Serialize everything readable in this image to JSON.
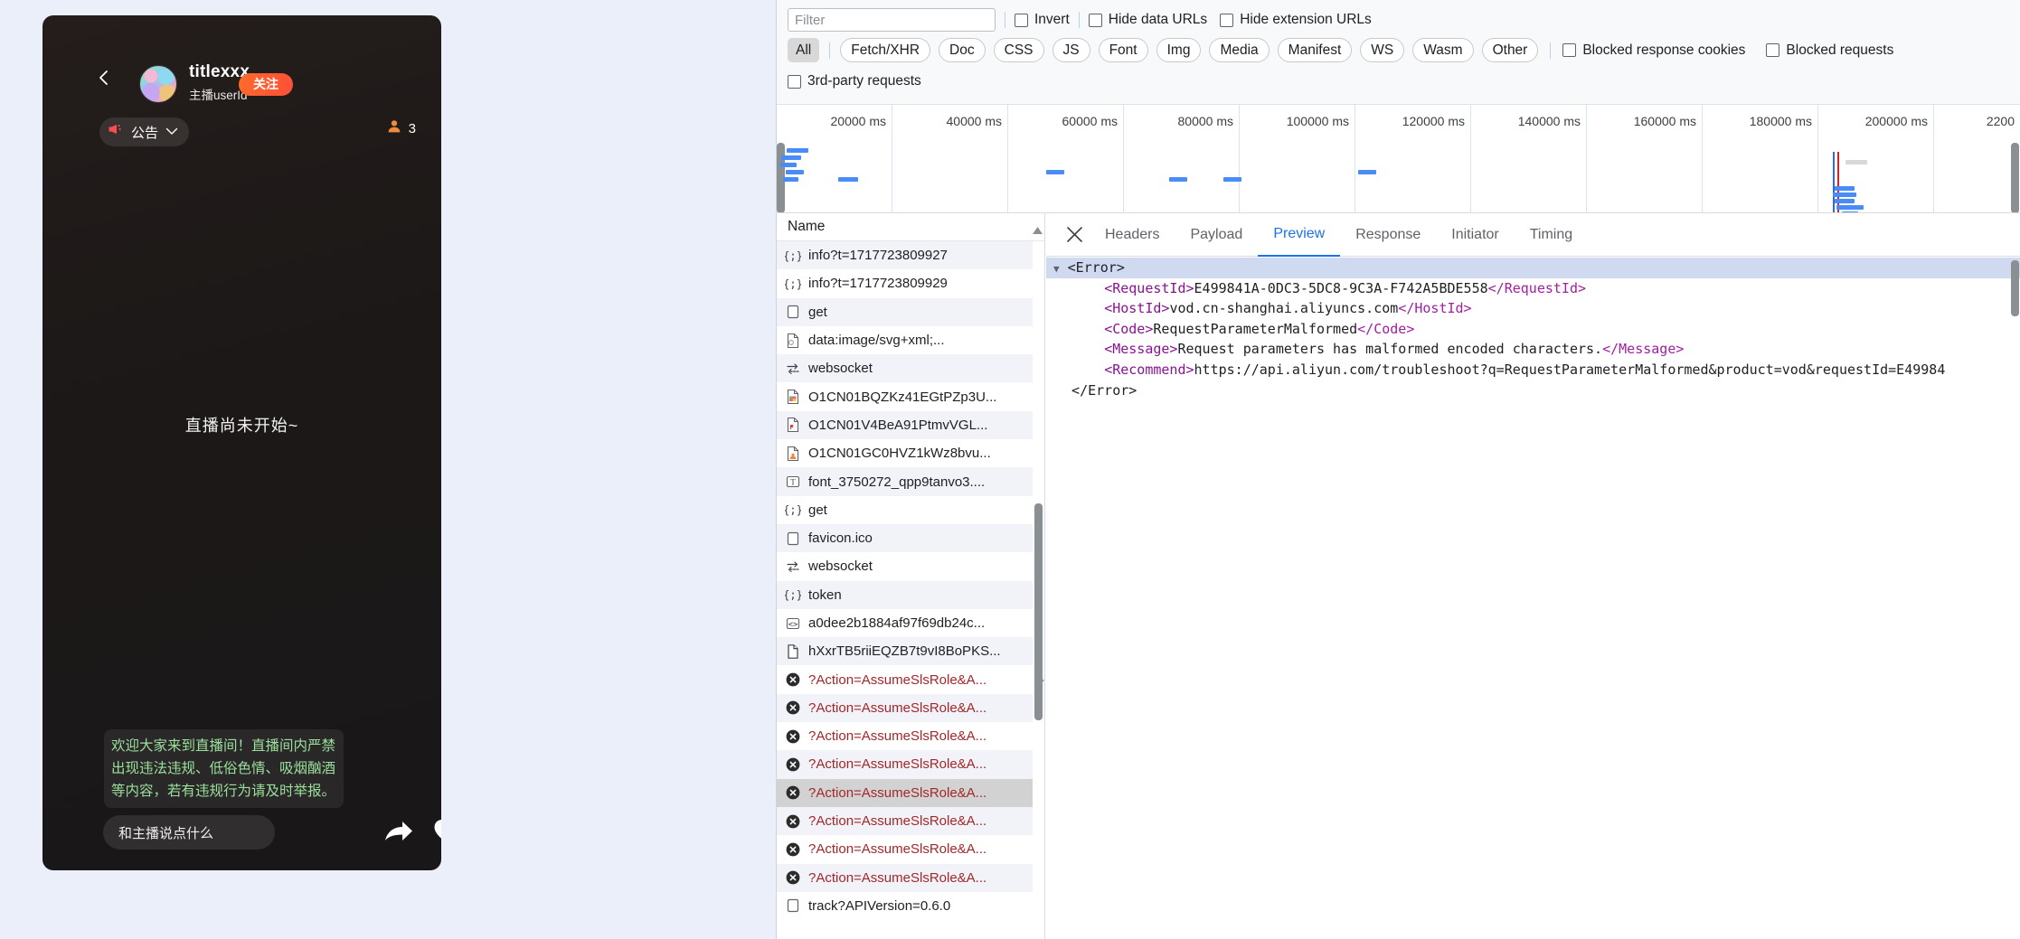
{
  "live": {
    "back_icon": "chevron-left-icon",
    "host_name": "titlexxx",
    "host_sub": "主播userId",
    "follow_label": "关注",
    "notice_label": "公告",
    "notice_icon": "megaphone-icon",
    "chevron_icon": "chevron-down-icon",
    "viewer_icon": "person-icon",
    "viewer_count": "3",
    "center_text": "直播尚未开始~",
    "system_message": "欢迎大家来到直播间！直播间内严禁出现违法违规、低俗色情、吸烟酗酒等内容，若有违规行为请及时举报。",
    "chat_placeholder": "和主播说点什么",
    "share_icon": "share-arrow-icon",
    "heart_icon": "heart-icon",
    "accent_color": "#ff5a32",
    "system_msg_color": "#9ae09c"
  },
  "devtools": {
    "filter": {
      "placeholder": "Filter",
      "value": ""
    },
    "checkboxes": [
      {
        "label": "Invert",
        "checked": false
      },
      {
        "label": "Hide data URLs",
        "checked": false
      },
      {
        "label": "Hide extension URLs",
        "checked": false
      },
      {
        "label": "Blocked response cookies",
        "checked": false
      },
      {
        "label": "Blocked requests",
        "checked": false
      },
      {
        "label": "3rd-party requests",
        "checked": false
      }
    ],
    "type_filters": [
      {
        "label": "All",
        "active": true
      },
      {
        "label": "Fetch/XHR",
        "active": false
      },
      {
        "label": "Doc",
        "active": false
      },
      {
        "label": "CSS",
        "active": false
      },
      {
        "label": "JS",
        "active": false
      },
      {
        "label": "Font",
        "active": false
      },
      {
        "label": "Img",
        "active": false
      },
      {
        "label": "Media",
        "active": false
      },
      {
        "label": "Manifest",
        "active": false
      },
      {
        "label": "WS",
        "active": false
      },
      {
        "label": "Wasm",
        "active": false
      },
      {
        "label": "Other",
        "active": false
      }
    ],
    "overview": {
      "ticks": [
        "20000 ms",
        "40000 ms",
        "60000 ms",
        "80000 ms",
        "100000 ms",
        "120000 ms",
        "140000 ms",
        "160000 ms",
        "180000 ms",
        "200000 ms",
        "2200"
      ],
      "bar_color": "#4a8cf7",
      "dom_line_color": "#2b6ae3",
      "load_line_color": "#e02020"
    },
    "list": {
      "column_header": "Name",
      "rows": [
        {
          "name": "info?t=1717723809927",
          "icon": "json-icon",
          "state": "normal"
        },
        {
          "name": "info?t=1717723809929",
          "icon": "json-icon",
          "state": "normal"
        },
        {
          "name": "get",
          "icon": "doc-icon",
          "state": "normal"
        },
        {
          "name": "data:image/svg+xml;...",
          "icon": "image-file-icon",
          "state": "normal"
        },
        {
          "name": "websocket",
          "icon": "websocket-icon",
          "state": "normal"
        },
        {
          "name": "O1CN01BQZKz41EGtPZp3U...",
          "icon": "image-color-icon",
          "state": "normal"
        },
        {
          "name": "O1CN01V4BeA91PtmvVGL...",
          "icon": "image-red-icon",
          "state": "normal"
        },
        {
          "name": "O1CN01GC0HVZ1kWz8bvu...",
          "icon": "image-orange-icon",
          "state": "normal"
        },
        {
          "name": "font_3750272_qpp9tanvo3....",
          "icon": "font-icon",
          "state": "normal"
        },
        {
          "name": "get",
          "icon": "json-icon",
          "state": "normal"
        },
        {
          "name": "favicon.ico",
          "icon": "doc-icon",
          "state": "normal"
        },
        {
          "name": "websocket",
          "icon": "websocket-icon",
          "state": "normal"
        },
        {
          "name": "token",
          "icon": "json-icon",
          "state": "normal"
        },
        {
          "name": "a0dee2b1884af97f69db24c...",
          "icon": "script-icon",
          "state": "normal"
        },
        {
          "name": "hXxrTB5riiEQZB7t9vI8BoPKS...",
          "icon": "plain-file-icon",
          "state": "normal"
        },
        {
          "name": "?Action=AssumeSlsRole&A...",
          "icon": "error-icon",
          "state": "error"
        },
        {
          "name": "?Action=AssumeSlsRole&A...",
          "icon": "error-icon",
          "state": "error"
        },
        {
          "name": "?Action=AssumeSlsRole&A...",
          "icon": "error-icon",
          "state": "error"
        },
        {
          "name": "?Action=AssumeSlsRole&A...",
          "icon": "error-icon",
          "state": "error"
        },
        {
          "name": "?Action=AssumeSlsRole&A...",
          "icon": "error-icon",
          "state": "error-selected"
        },
        {
          "name": "?Action=AssumeSlsRole&A...",
          "icon": "error-icon",
          "state": "error"
        },
        {
          "name": "?Action=AssumeSlsRole&A...",
          "icon": "error-icon",
          "state": "error"
        },
        {
          "name": "?Action=AssumeSlsRole&A...",
          "icon": "error-icon",
          "state": "error"
        },
        {
          "name": "track?APIVersion=0.6.0",
          "icon": "doc-icon",
          "state": "normal"
        }
      ]
    },
    "details": {
      "close_icon": "close-icon",
      "tabs": [
        {
          "label": "Headers",
          "active": false
        },
        {
          "label": "Payload",
          "active": false
        },
        {
          "label": "Preview",
          "active": true
        },
        {
          "label": "Response",
          "active": false
        },
        {
          "label": "Initiator",
          "active": false
        },
        {
          "label": "Timing",
          "active": false
        }
      ],
      "preview_xml": {
        "root_open": "<Error>",
        "root_close": "</Error>",
        "lines": [
          {
            "indent": 4,
            "tag": "RequestId",
            "value": "E499841A-0DC3-5DC8-9C3A-F742A5BDE558"
          },
          {
            "indent": 4,
            "tag": "HostId",
            "value": "vod.cn-shanghai.aliyuncs.com"
          },
          {
            "indent": 4,
            "tag": "Code",
            "value": "RequestParameterMalformed"
          },
          {
            "indent": 4,
            "tag": "Message",
            "value": "Request parameters has malformed encoded characters."
          },
          {
            "indent": 4,
            "tag": "Recommend",
            "value": "https://api.aliyun.com/troubleshoot?q=RequestParameterMalformed&product=vod&requestId=E49984"
          }
        ]
      }
    }
  }
}
